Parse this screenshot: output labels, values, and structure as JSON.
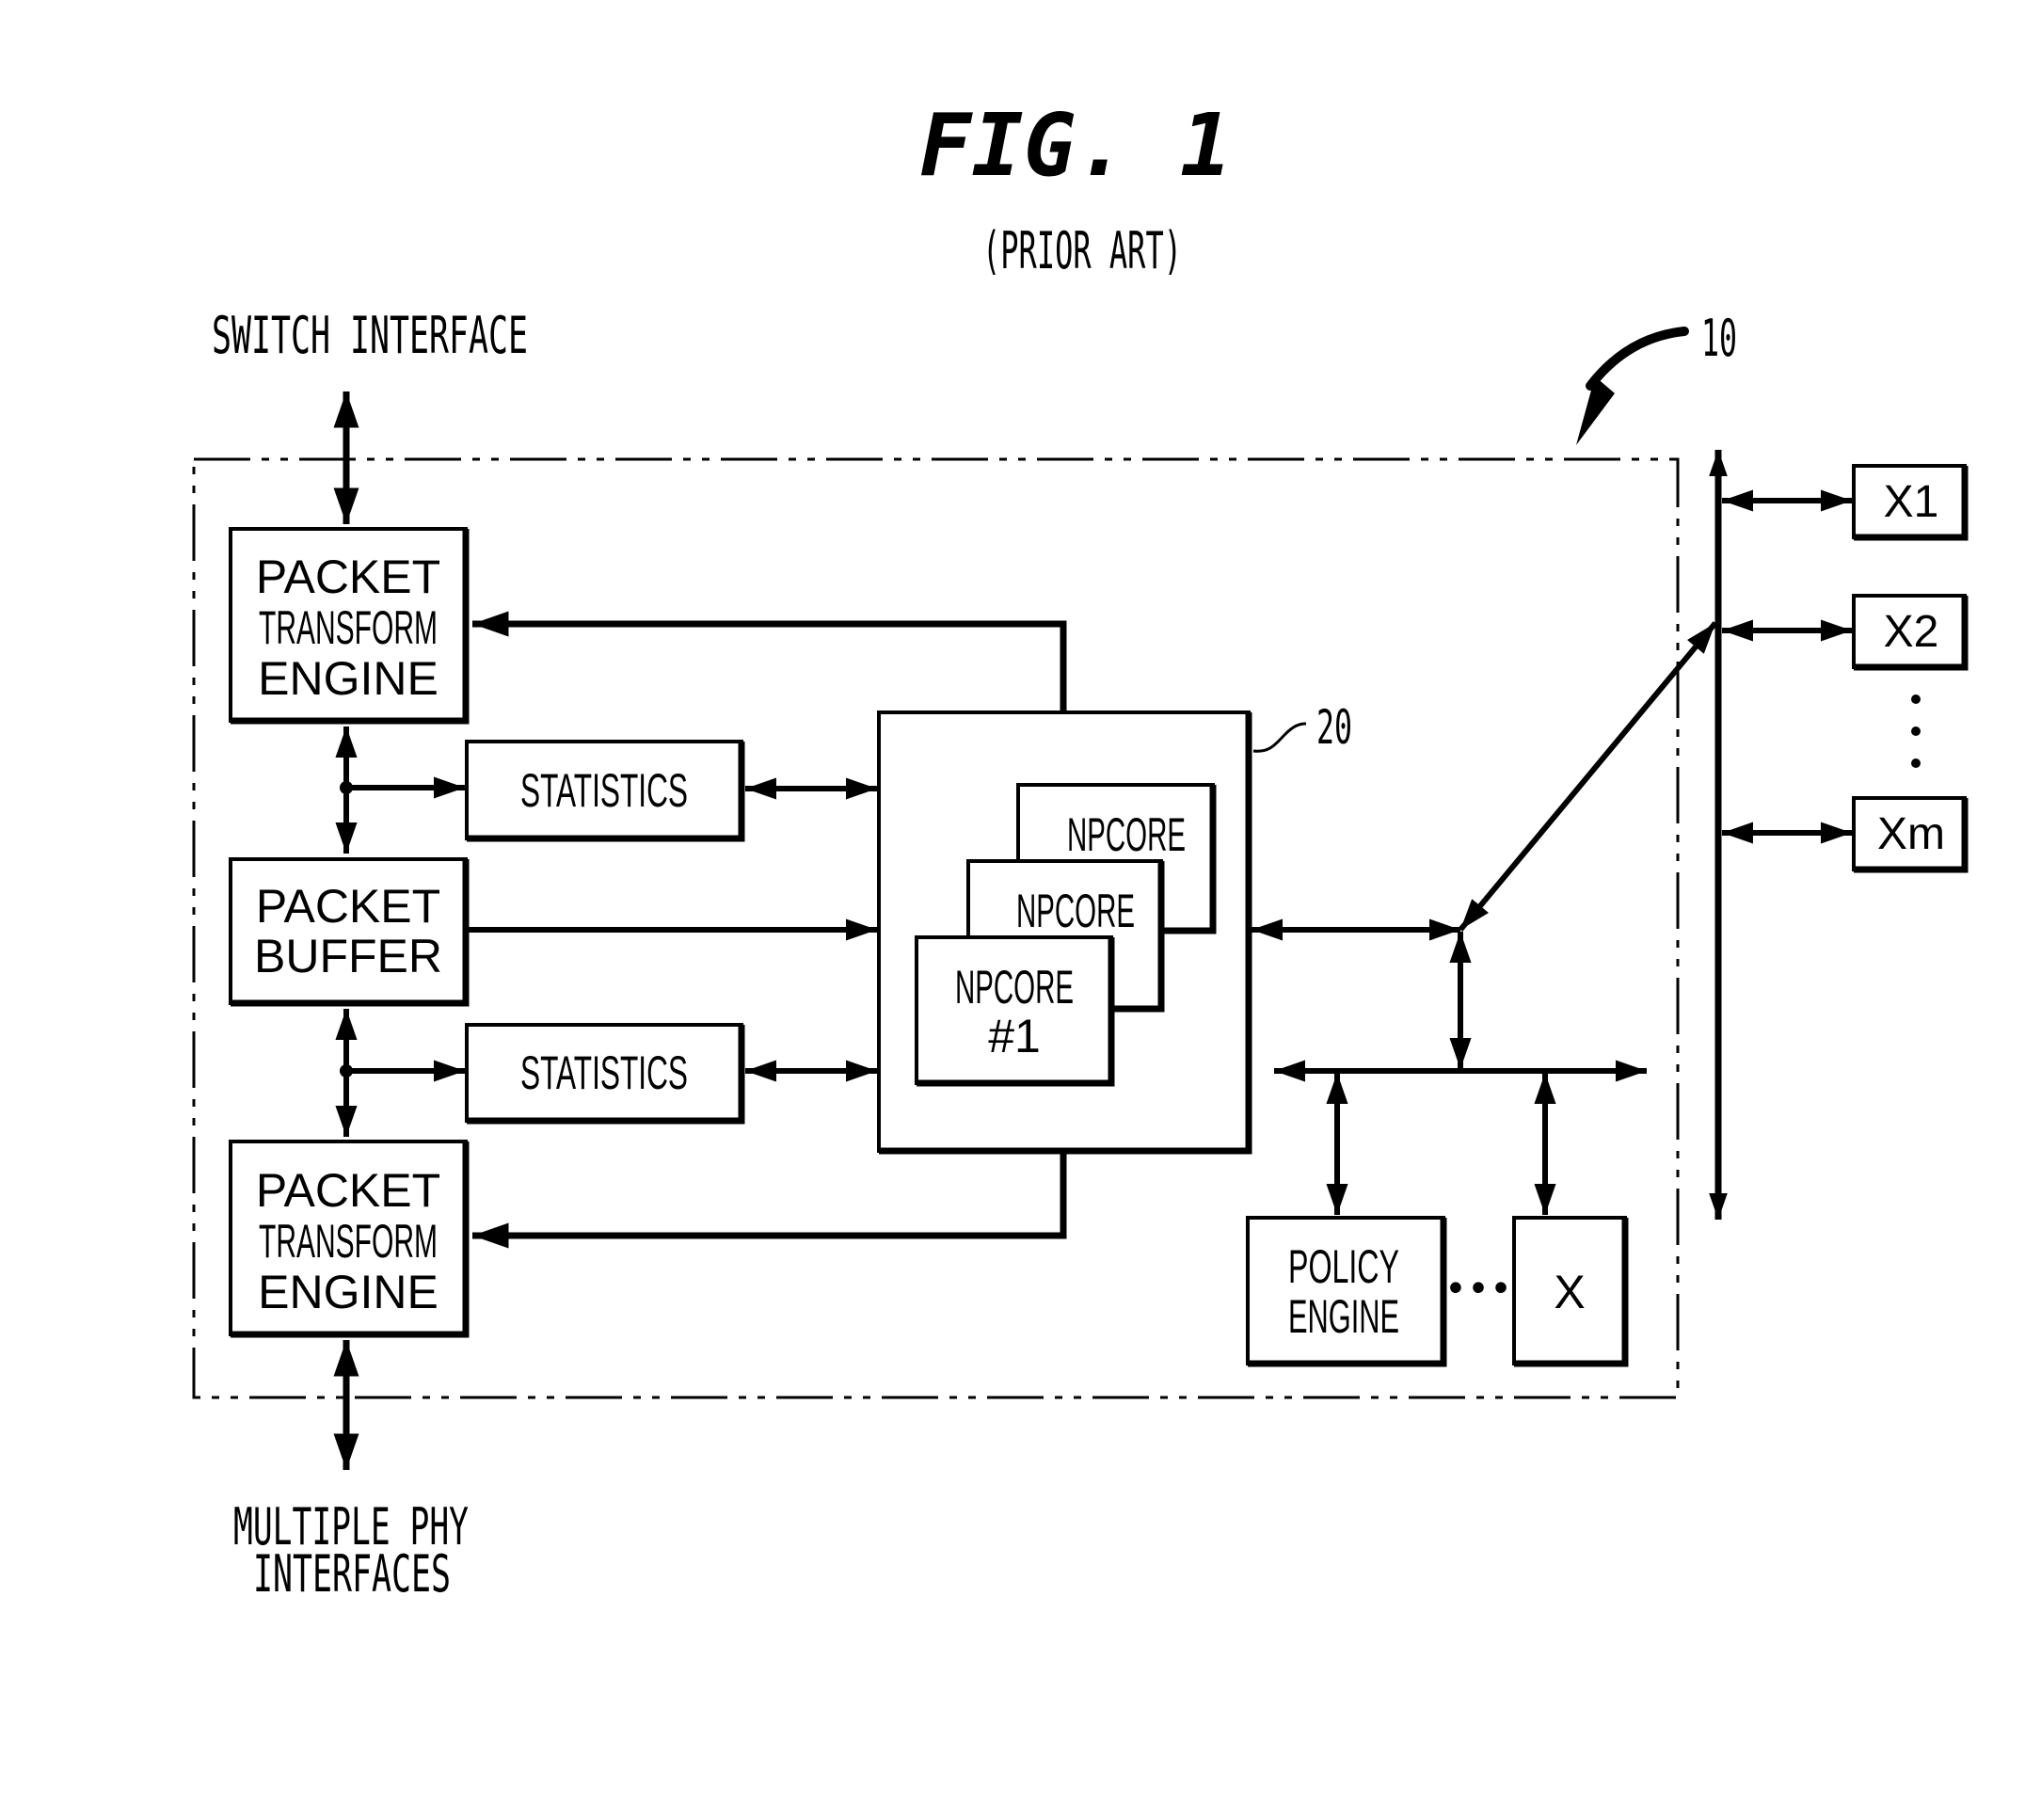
{
  "figure": {
    "title": "FIG. 1",
    "subtitle": "(PRIOR ART)",
    "reference_numeral": "10"
  },
  "external_labels": {
    "switch_interface": "SWITCH INTERFACE",
    "phy_line1": "MULTIPLE PHY",
    "phy_line2": "INTERFACES"
  },
  "blocks": {
    "pte_top": [
      "PACKET",
      "TRANSFORM",
      "ENGINE"
    ],
    "statistics_top": "STATISTICS",
    "packet_buffer": [
      "PACKET",
      "BUFFER"
    ],
    "statistics_bottom": "STATISTICS",
    "pte_bottom": [
      "PACKET",
      "TRANSFORM",
      "ENGINE"
    ],
    "np_reference": "20",
    "npcore_back": "NPCORE",
    "npcore_middle": "NPCORE",
    "npcore_front": [
      "NPCORE",
      "#1"
    ],
    "policy_engine": [
      "POLICY",
      "ENGINE"
    ],
    "ellipsis": "•••",
    "x_box": "X",
    "x1": "X1",
    "x2": "X2",
    "xm": "Xm"
  },
  "colors": {
    "ink": "#000000",
    "paper": "#ffffff"
  }
}
